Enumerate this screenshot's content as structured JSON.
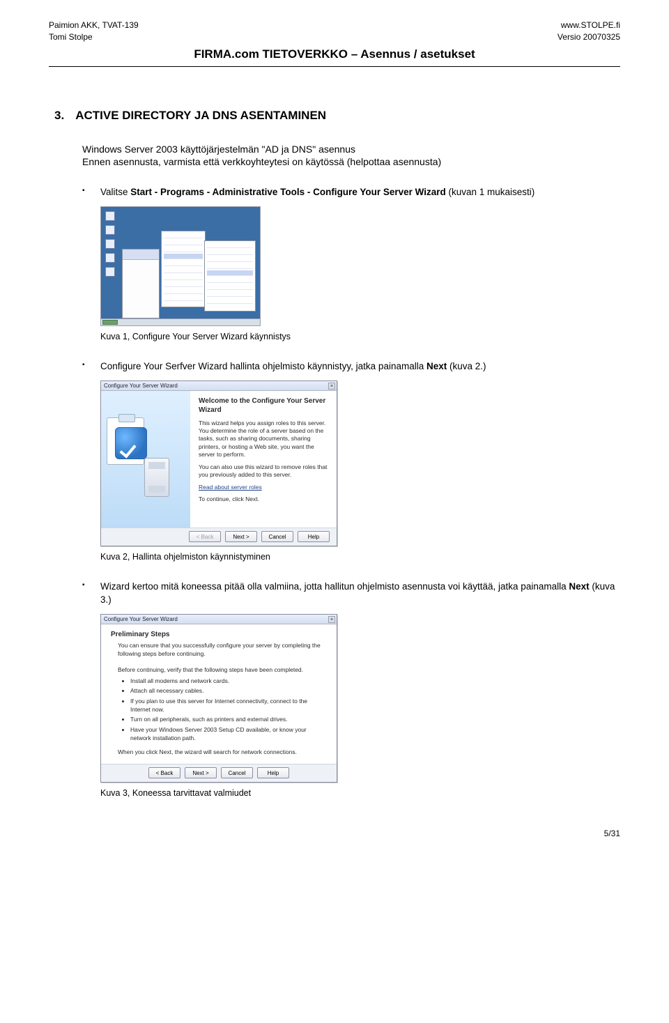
{
  "header": {
    "left1": "Paimion AKK, TVAT-139",
    "left2": "Tomi Stolpe",
    "right1": "www.STOLPE.fi",
    "right2": "Versio 20070325",
    "title": "FIRMA.com TIETOVERKKO – Asennus / asetukset"
  },
  "section": {
    "num": "3.",
    "title": "ACTIVE DIRECTORY JA DNS ASENTAMINEN"
  },
  "lead": {
    "l1": "Windows Server 2003 käyttöjärjestelmän \"AD ja DNS\" asennus",
    "l2": "Ennen asennusta, varmista että verkkoyhteytesi on käytössä (helpottaa asennusta)"
  },
  "b1": {
    "pre": "Valitse ",
    "bold": "Start - Programs - Administrative Tools - Configure Your Server Wizard",
    "post": " (kuvan 1 mukaisesti)"
  },
  "cap1": "Kuva 1, Configure Your Server Wizard käynnistys",
  "b2": {
    "pre": "Configure Your Serfver Wizard hallinta ohjelmisto käynnistyy, jatka painamalla ",
    "bold": "Next",
    "post": " (kuva 2.)"
  },
  "wiz2": {
    "title": "Configure Your Server Wizard",
    "h": "Welcome to the Configure Your Server Wizard",
    "p1": "This wizard helps you assign roles to this server. You determine the role of a server based on the tasks, such as sharing documents, sharing printers, or hosting a Web site, you want the server to perform.",
    "p2": "You can also use this wizard to remove roles that you previously added to this server.",
    "link": "Read about server roles",
    "p3": "To continue, click Next.",
    "back": "< Back",
    "next": "Next >",
    "cancel": "Cancel",
    "help": "Help"
  },
  "cap2": "Kuva 2, Hallinta ohjelmiston käynnistyminen",
  "b3": {
    "pre": "Wizard kertoo mitä koneessa pitää olla valmiina, jotta hallitun ohjelmisto asennusta voi käyttää, jatka painamalla ",
    "bold": "Next",
    "post": " (kuva 3.)"
  },
  "wiz3": {
    "title": "Configure Your Server Wizard",
    "h": "Preliminary Steps",
    "sub": "You can ensure that you successfully configure your server by completing the following steps before continuing.",
    "lead": "Before continuing, verify that the following steps have been completed.",
    "bl": [
      "Install all modems and network cards.",
      "Attach all necessary cables.",
      "If you plan to use this server for Internet connectivity, connect to the Internet now.",
      "Turn on all peripherals, such as printers and external drives.",
      "Have your Windows Server 2003 Setup CD available, or know your network installation path."
    ],
    "after": "When you click Next, the wizard will search for network connections.",
    "back": "< Back",
    "next": "Next >",
    "cancel": "Cancel",
    "help": "Help"
  },
  "cap3": "Kuva 3, Koneessa tarvittavat valmiudet",
  "footer": "5/31"
}
